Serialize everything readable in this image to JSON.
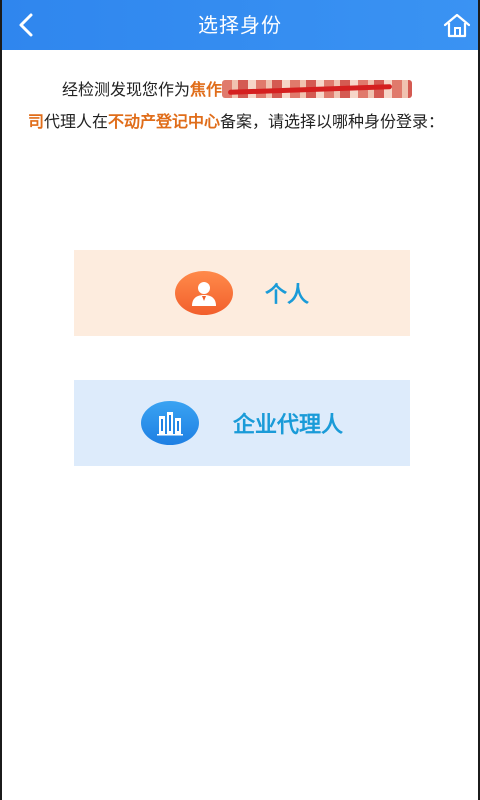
{
  "header": {
    "title": "选择身份",
    "back_icon": "chevron-left-icon",
    "home_icon": "home-icon",
    "color": "#3a93f3"
  },
  "message": {
    "prefix": "经检测发现您作为",
    "company_visible_start": "焦作",
    "company_visible_end": "司",
    "middle": "代理人在",
    "center": "不动产登记中心",
    "suffix": "备案，请选择以哪种身份登录："
  },
  "options": [
    {
      "label": "个人",
      "icon": "person-icon",
      "bg": "#fdecde",
      "accent": "#f25f2c"
    },
    {
      "label": "企业代理人",
      "icon": "building-icon",
      "bg": "#ddebfb",
      "accent": "#1e7fe3"
    }
  ]
}
